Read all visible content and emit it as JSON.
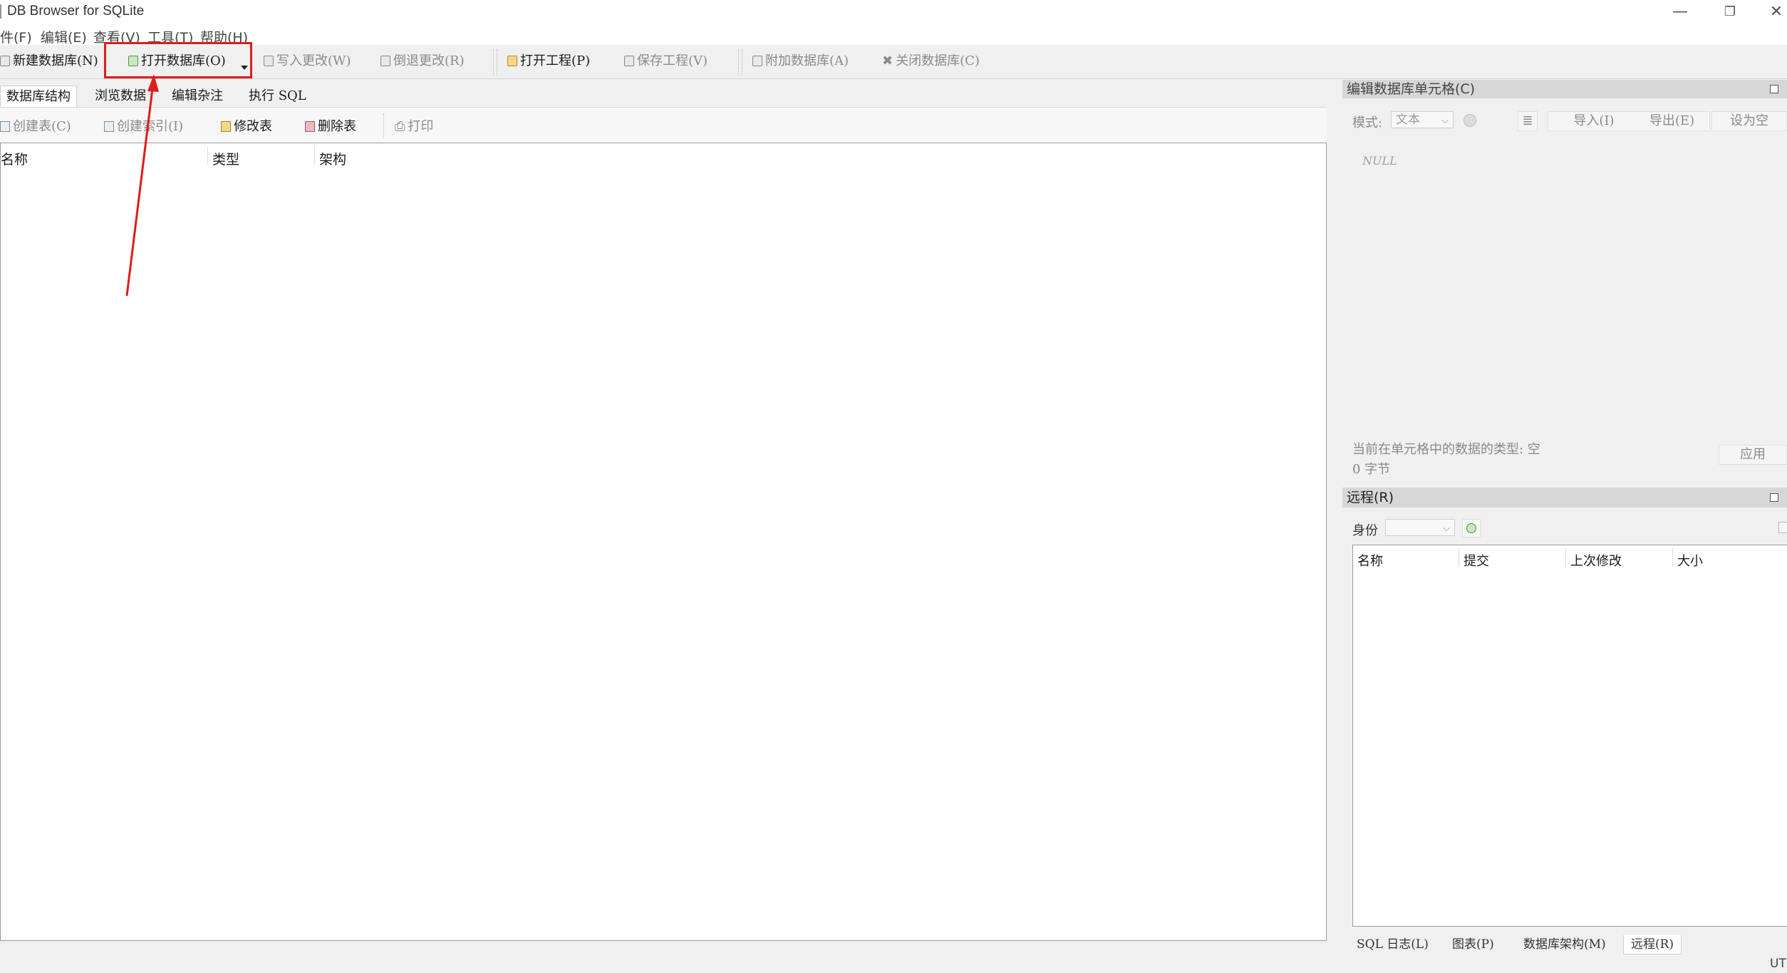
{
  "window": {
    "title": "DB Browser for SQLite",
    "minimize": "—",
    "restore": "❐",
    "close": "✕"
  },
  "menubar": [
    "件(F)",
    "编辑(E)",
    "查看(V)",
    "工具(T)",
    "帮助(H)"
  ],
  "toolbar": {
    "new_db": "新建数据库(N)",
    "open_db": "打开数据库(O)",
    "write_changes": "写入更改(W)",
    "revert_changes": "倒退更改(R)",
    "open_project": "打开工程(P)",
    "save_project": "保存工程(V)",
    "attach_db": "附加数据库(A)",
    "close_db": "关闭数据库(C)"
  },
  "tabs": [
    "数据库结构",
    "浏览数据",
    "编辑杂注",
    "执行 SQL"
  ],
  "structure_toolbar": {
    "create_table": "创建表(C)",
    "create_index": "创建索引(I)",
    "modify_table": "修改表",
    "delete_table": "删除表",
    "print": "打印"
  },
  "structure_columns": [
    "名称",
    "类型",
    "架构"
  ],
  "cell_editor": {
    "title": "编辑数据库单元格(C)",
    "mode_label": "模式:",
    "mode_value": "文本",
    "import": "导入(I)",
    "export": "导出(E)",
    "set_null": "设为空",
    "null_text": "NULL",
    "type_info": "当前在单元格中的数据的类型: 空",
    "size_info": "0 字节",
    "apply": "应用"
  },
  "remote": {
    "title": "远程(R)",
    "identity_label": "身份",
    "columns": [
      "名称",
      "提交",
      "上次修改",
      "大小"
    ]
  },
  "bottom_tabs": [
    "SQL 日志(L)",
    "图表(P)",
    "数据库架构(M)",
    "远程(R)"
  ],
  "status": {
    "encoding": "UT"
  },
  "colors": {
    "highlight": "#e01b1b",
    "arrow": "#e01b1b"
  }
}
